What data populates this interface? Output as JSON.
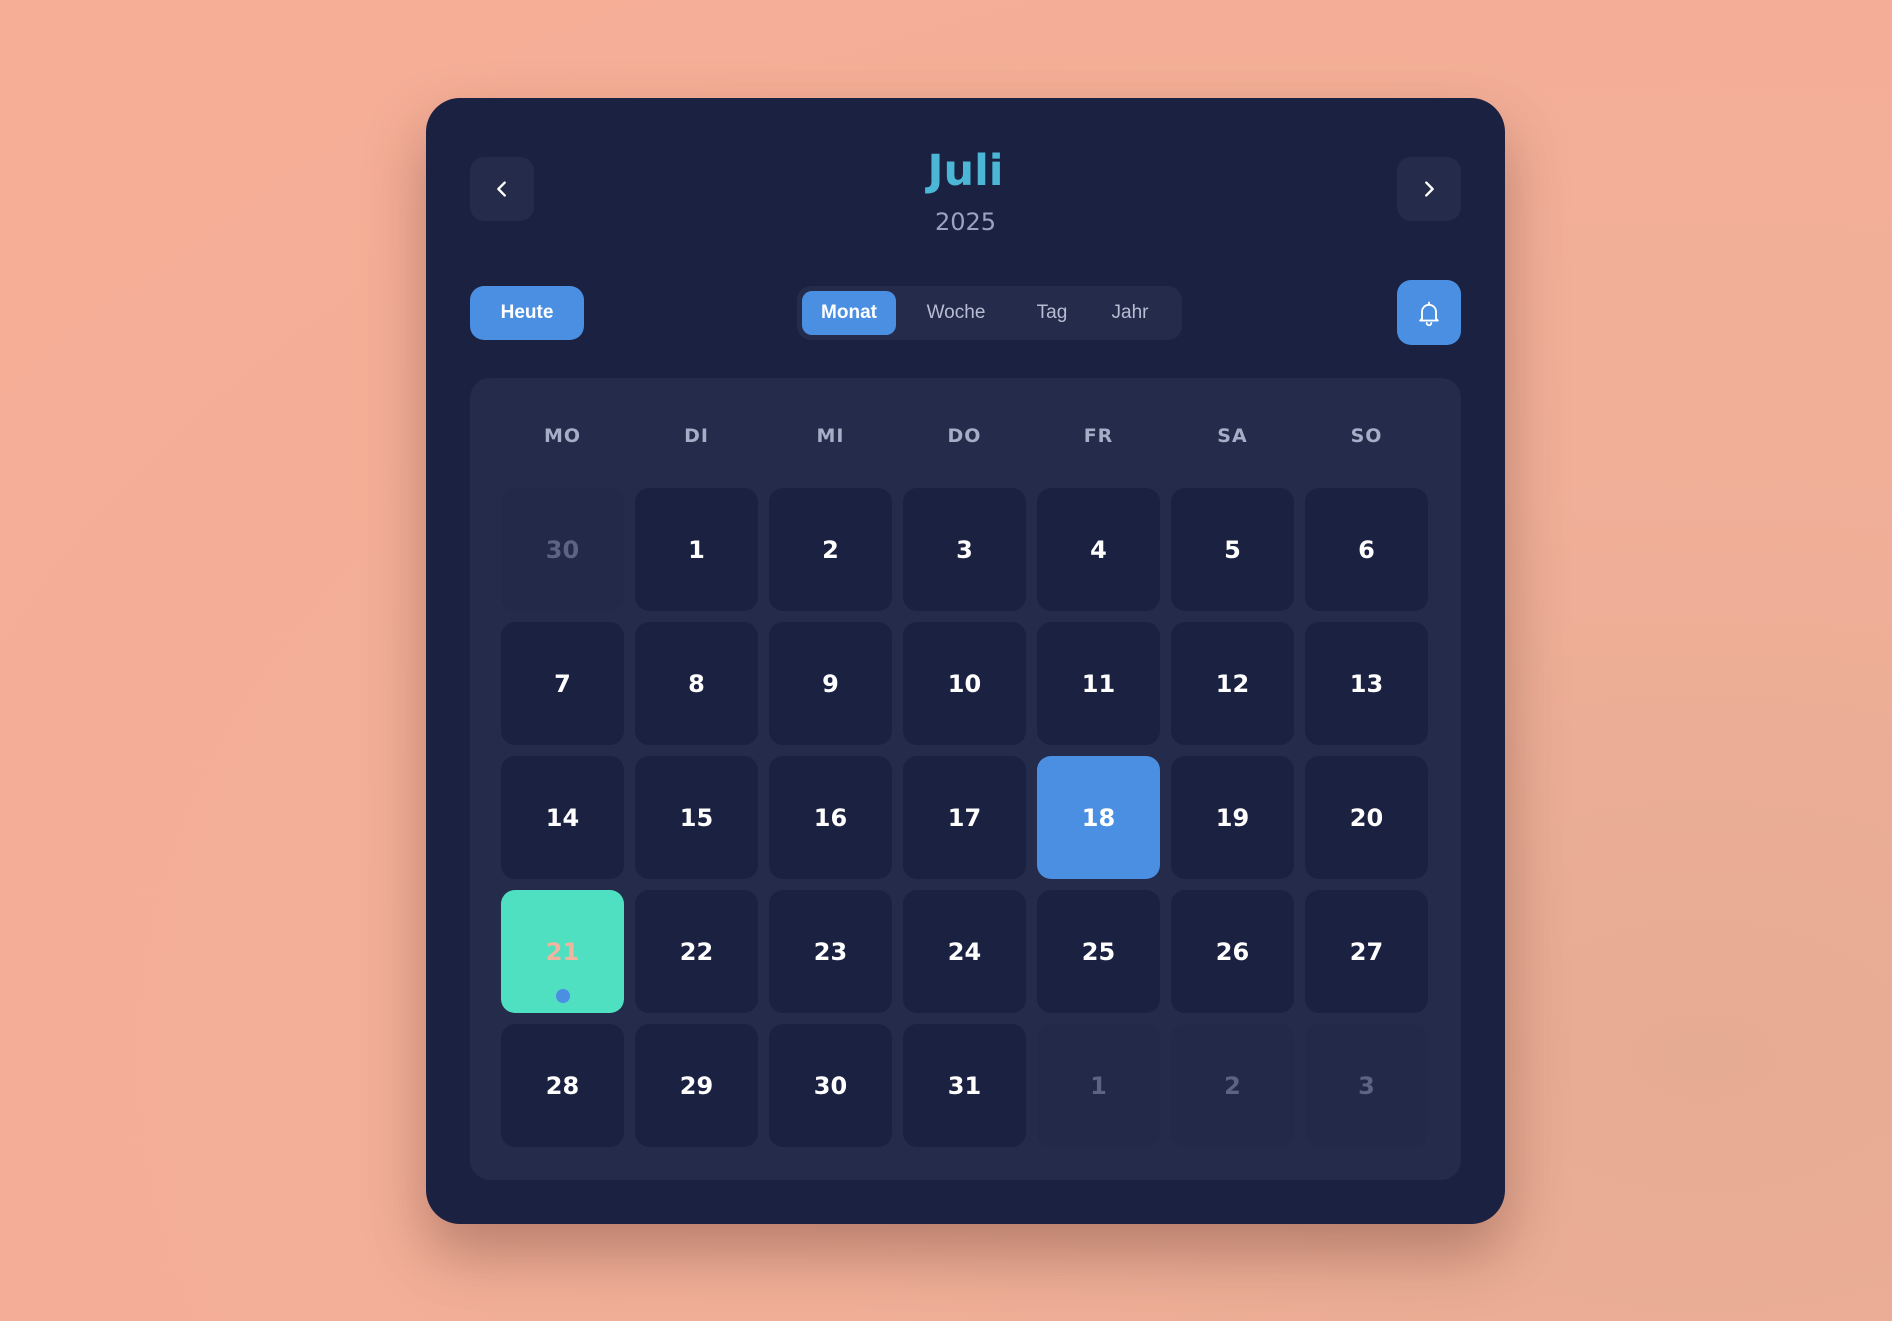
{
  "header": {
    "month": "Juli",
    "year": "2025",
    "prev_icon": "chevron-left-icon",
    "next_icon": "chevron-right-icon"
  },
  "toolbar": {
    "today_label": "Heute",
    "views": [
      {
        "label": "Monat",
        "active": true
      },
      {
        "label": "Woche",
        "active": false
      },
      {
        "label": "Tag",
        "active": false
      },
      {
        "label": "Jahr",
        "active": false
      }
    ],
    "bell_icon": "bell-icon"
  },
  "weekdays": [
    "MO",
    "DI",
    "MI",
    "DO",
    "FR",
    "SA",
    "SO"
  ],
  "days": [
    {
      "label": "30",
      "state": "other"
    },
    {
      "label": "1",
      "state": "current"
    },
    {
      "label": "2",
      "state": "current"
    },
    {
      "label": "3",
      "state": "current"
    },
    {
      "label": "4",
      "state": "current"
    },
    {
      "label": "5",
      "state": "current"
    },
    {
      "label": "6",
      "state": "current"
    },
    {
      "label": "7",
      "state": "current"
    },
    {
      "label": "8",
      "state": "current"
    },
    {
      "label": "9",
      "state": "current"
    },
    {
      "label": "10",
      "state": "current"
    },
    {
      "label": "11",
      "state": "current"
    },
    {
      "label": "12",
      "state": "current"
    },
    {
      "label": "13",
      "state": "current"
    },
    {
      "label": "14",
      "state": "current"
    },
    {
      "label": "15",
      "state": "current"
    },
    {
      "label": "16",
      "state": "current"
    },
    {
      "label": "17",
      "state": "current"
    },
    {
      "label": "18",
      "state": "selected"
    },
    {
      "label": "19",
      "state": "current"
    },
    {
      "label": "20",
      "state": "current"
    },
    {
      "label": "21",
      "state": "today",
      "has_event": true
    },
    {
      "label": "22",
      "state": "current"
    },
    {
      "label": "23",
      "state": "current"
    },
    {
      "label": "24",
      "state": "current"
    },
    {
      "label": "25",
      "state": "current"
    },
    {
      "label": "26",
      "state": "current"
    },
    {
      "label": "27",
      "state": "current"
    },
    {
      "label": "28",
      "state": "current"
    },
    {
      "label": "29",
      "state": "current"
    },
    {
      "label": "30",
      "state": "current"
    },
    {
      "label": "31",
      "state": "current"
    },
    {
      "label": "1",
      "state": "other"
    },
    {
      "label": "2",
      "state": "other"
    },
    {
      "label": "3",
      "state": "other"
    }
  ],
  "colors": {
    "accent": "#4a8fe2",
    "title": "#4cb6d6",
    "today": "#4fe0c2",
    "card": "#1b2140",
    "panel": "#252b4a",
    "background": "#f7ae97"
  }
}
